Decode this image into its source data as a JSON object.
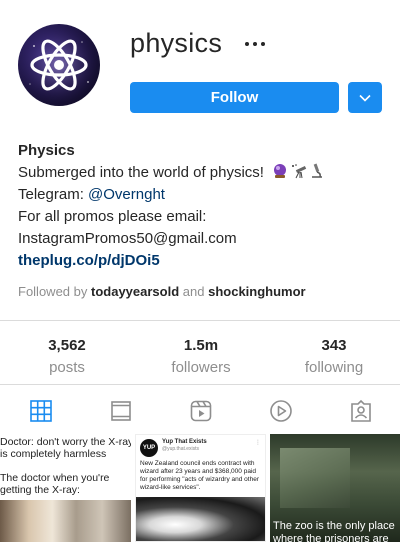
{
  "profile": {
    "username": "physics",
    "follow_label": "Follow"
  },
  "bio": {
    "name": "Physics",
    "line1": "Submerged into the world of physics!",
    "telegram_prefix": "Telegram: ",
    "telegram_handle": "@Overnght",
    "line3": "For all promos please email:",
    "email": "InstagramPromos50@gmail.com",
    "link": "theplug.co/p/djDOi5"
  },
  "followed_by": {
    "prefix": "Followed by",
    "user1": "todayyearsold",
    "conj": "and",
    "user2": "shockinghumor"
  },
  "stats": [
    {
      "value": "3,562",
      "label": "posts"
    },
    {
      "value": "1.5m",
      "label": "followers"
    },
    {
      "value": "343",
      "label": "following"
    }
  ],
  "tabs": [
    {
      "icon": "grid-icon"
    },
    {
      "icon": "feed-icon"
    },
    {
      "icon": "reels-icon"
    },
    {
      "icon": "video-icon"
    },
    {
      "icon": "tagged-icon"
    }
  ],
  "posts": {
    "p1": {
      "text1": "Doctor: don't worry the X-ray is completely harmless",
      "text2": "The doctor when you're getting the X-ray:"
    },
    "p2": {
      "logo": "YUP",
      "source": "Yup That Exists",
      "source_handle": "@yup.that.exists",
      "headline": "New Zealand council ends contract with wizard after 23 years and $368,000 paid for performing \"acts of wizardry and other wizard-like services\"."
    },
    "p3": {
      "caption": "The zoo is the only place where the prisoners are"
    }
  },
  "colors": {
    "accent": "#1a8cf0",
    "link": "#00376b",
    "muted": "#8e8e8e",
    "active_tab": "#1a8cf0"
  }
}
